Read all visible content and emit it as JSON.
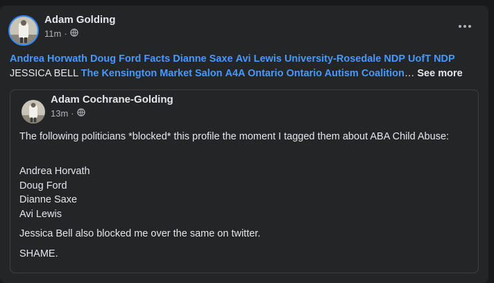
{
  "post": {
    "author": "Adam Golding",
    "time": "11m",
    "dot": "·",
    "tags_line1": [
      "Andrea Horwath",
      "Doug Ford",
      "Facts",
      "Dianne Saxe",
      "Avi Lewis",
      "University-Rosedale NDP",
      "UofT NDP"
    ],
    "plain_tag": "JESSICA BELL",
    "tags_line2": [
      "The Kensington Market Salon",
      "A4A Ontario",
      "Ontario Autism Coalition"
    ],
    "ellipsis": "…",
    "see_more": "See more"
  },
  "shared": {
    "author": "Adam Cochrane-Golding",
    "time": "13m",
    "dot": "·",
    "paragraph1": "The following politicians *blocked* this profile the moment I tagged them about ABA Child Abuse:",
    "list": [
      "Andrea Horvath",
      "Doug Ford",
      "Dianne Saxe",
      "Avi Lewis"
    ],
    "paragraph2": "Jessica Bell also blocked me over the same on twitter.",
    "paragraph3": "SHAME."
  },
  "colors": {
    "link": "#4599ff",
    "card": "#242526",
    "background": "#18191a",
    "muted": "#b0b3b8"
  },
  "icons": [
    "globe-icon",
    "more-options-icon"
  ]
}
